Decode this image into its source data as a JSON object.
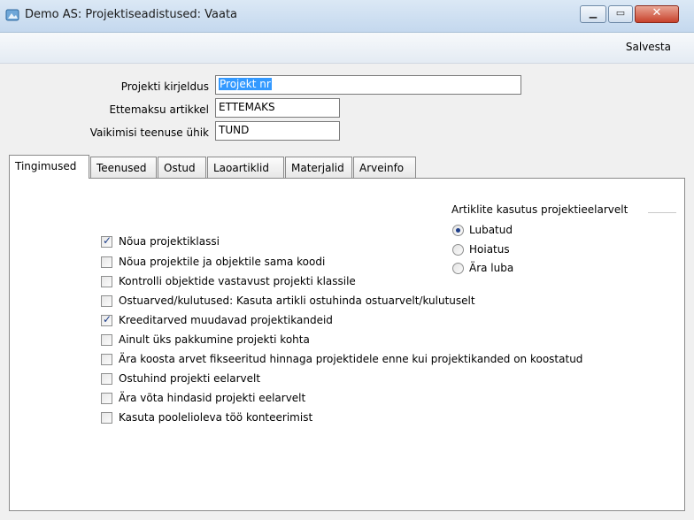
{
  "window": {
    "title": "Demo AS: Projektiseadistused: Vaata",
    "app_icon": "app-icon",
    "minimize_icon": "minimize-icon",
    "maximize_icon": "maximize-icon",
    "close_icon": "close-icon"
  },
  "toolbar": {
    "save_label": "Salvesta"
  },
  "form": {
    "project_description": {
      "label": "Projekti kirjeldus",
      "value": "Projekt nr"
    },
    "prepayment_item": {
      "label": "Ettemaksu artikkel",
      "value": "ETTEMAKS"
    },
    "default_service_unit": {
      "label": "Vaikimisi teenuse ühik",
      "value": "TUND"
    }
  },
  "tabs": [
    {
      "label": "Tingimused",
      "active": true
    },
    {
      "label": "Teenused",
      "active": false
    },
    {
      "label": "Ostud",
      "active": false
    },
    {
      "label": "Laoartiklid",
      "active": false
    },
    {
      "label": "Materjalid",
      "active": false
    },
    {
      "label": "Arveinfo",
      "active": false
    }
  ],
  "conditions": {
    "checkboxes": [
      {
        "label": "Nõua projektiklassi",
        "checked": true
      },
      {
        "label": "Nõua projektile ja objektile sama koodi",
        "checked": false
      },
      {
        "label": "Kontrolli objektide vastavust projekti klassile",
        "checked": false
      },
      {
        "label": "Ostuarved/kulutused: Kasuta artikli ostuhinda ostuarvelt/kulutuselt",
        "checked": false
      },
      {
        "label": "Kreeditarved muudavad projektikandeid",
        "checked": true
      },
      {
        "label": "Ainult üks pakkumine projekti kohta",
        "checked": false
      },
      {
        "label": "Ära koosta arvet fikseeritud hinnaga projektidele enne kui projektikanded on koostatud",
        "checked": false
      },
      {
        "label": "Ostuhind projekti eelarvelt",
        "checked": false
      },
      {
        "label": "Ära võta hindasid projekti eelarvelt",
        "checked": false
      },
      {
        "label": "Kasuta poolelioleva töö konteerimist",
        "checked": false
      }
    ],
    "item_usage": {
      "title": "Artiklite kasutus projektieelarvelt",
      "options": [
        {
          "label": "Lubatud",
          "selected": true
        },
        {
          "label": "Hoiatus",
          "selected": false
        },
        {
          "label": "Ära luba",
          "selected": false
        }
      ]
    }
  }
}
